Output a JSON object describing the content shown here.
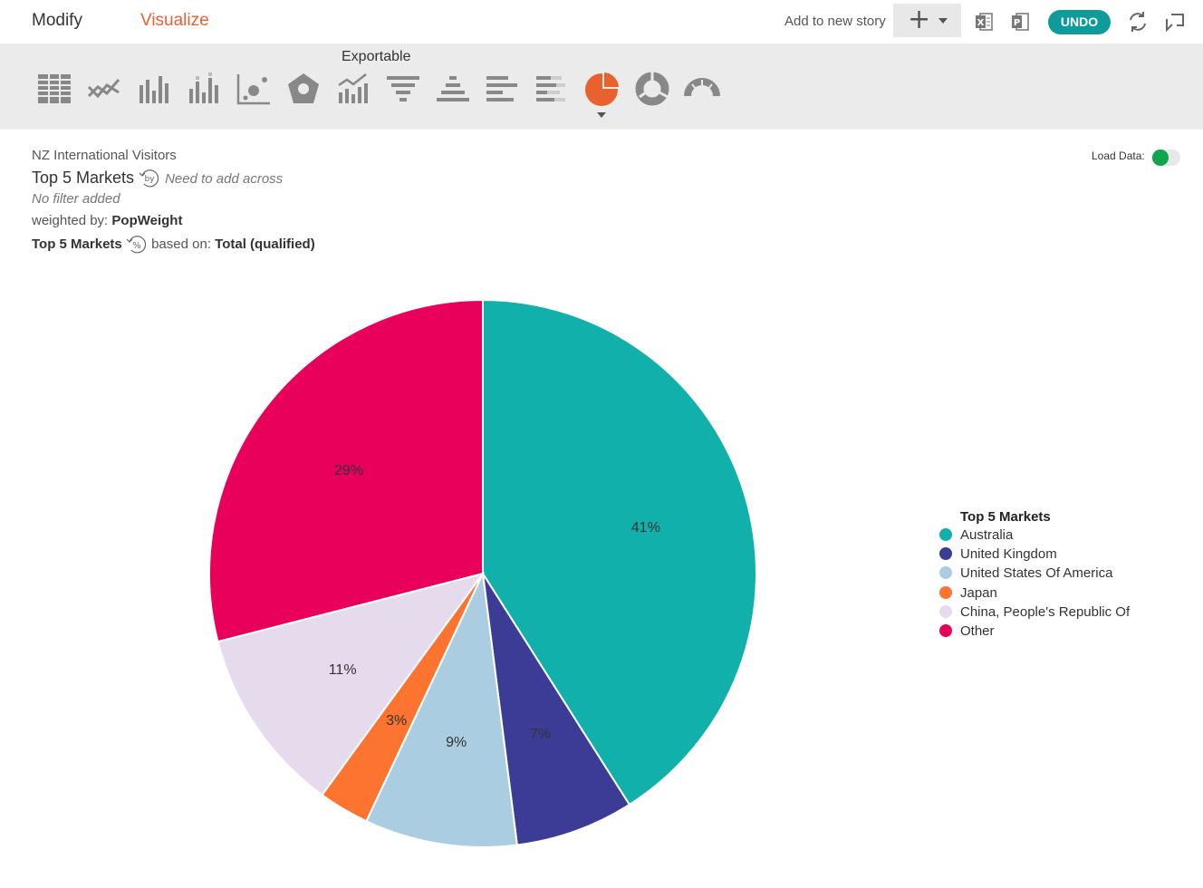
{
  "nav": {
    "modify": "Modify",
    "visualize": "Visualize",
    "add_to_story": "Add to new story",
    "add_symbol": "+",
    "undo": "UNDO"
  },
  "toolbar": {
    "exportable": "Exportable",
    "icons": [
      "table-icon",
      "line-chart-icon",
      "bar-chart-icon",
      "stacked-bar-icon",
      "scatter-icon",
      "radar-icon",
      "combo-chart-icon",
      "funnel-icon",
      "pyramid-icon",
      "horizontal-bar-icon",
      "stacked-horizontal-bar-icon",
      "pie-chart-icon",
      "donut-chart-icon",
      "gauge-icon"
    ],
    "selected": "pie-chart-icon"
  },
  "info": {
    "dataset": "NZ International Visitors",
    "title": "Top 5 Markets",
    "by_hint": "Need to add across",
    "filter": "No filter added",
    "weighted_label": "weighted by:",
    "weighted_value": "PopWeight",
    "base_var": "Top 5 Markets",
    "based_on_label": "based on:",
    "based_on_value": "Total (qualified)",
    "load_data": "Load Data:"
  },
  "chart_data": {
    "type": "pie",
    "categories": [
      "Australia",
      "United Kingdom",
      "United States Of America",
      "Japan",
      "China, People's Republic Of",
      "Other"
    ],
    "values": [
      41,
      7,
      9,
      3,
      11,
      29
    ],
    "labels": [
      "41%",
      "7%",
      "9%",
      "3%",
      "11%",
      "29%"
    ],
    "colors": [
      "#12b0aa",
      "#3c3c96",
      "#aacde2",
      "#fd7430",
      "#e6daed",
      "#e8005a"
    ],
    "legend_title": "Top 5 Markets",
    "legend_position": "right"
  },
  "colors": {
    "accent": "#e8622f",
    "undo": "#109b9b",
    "load_toggle": "#0fa64e"
  }
}
